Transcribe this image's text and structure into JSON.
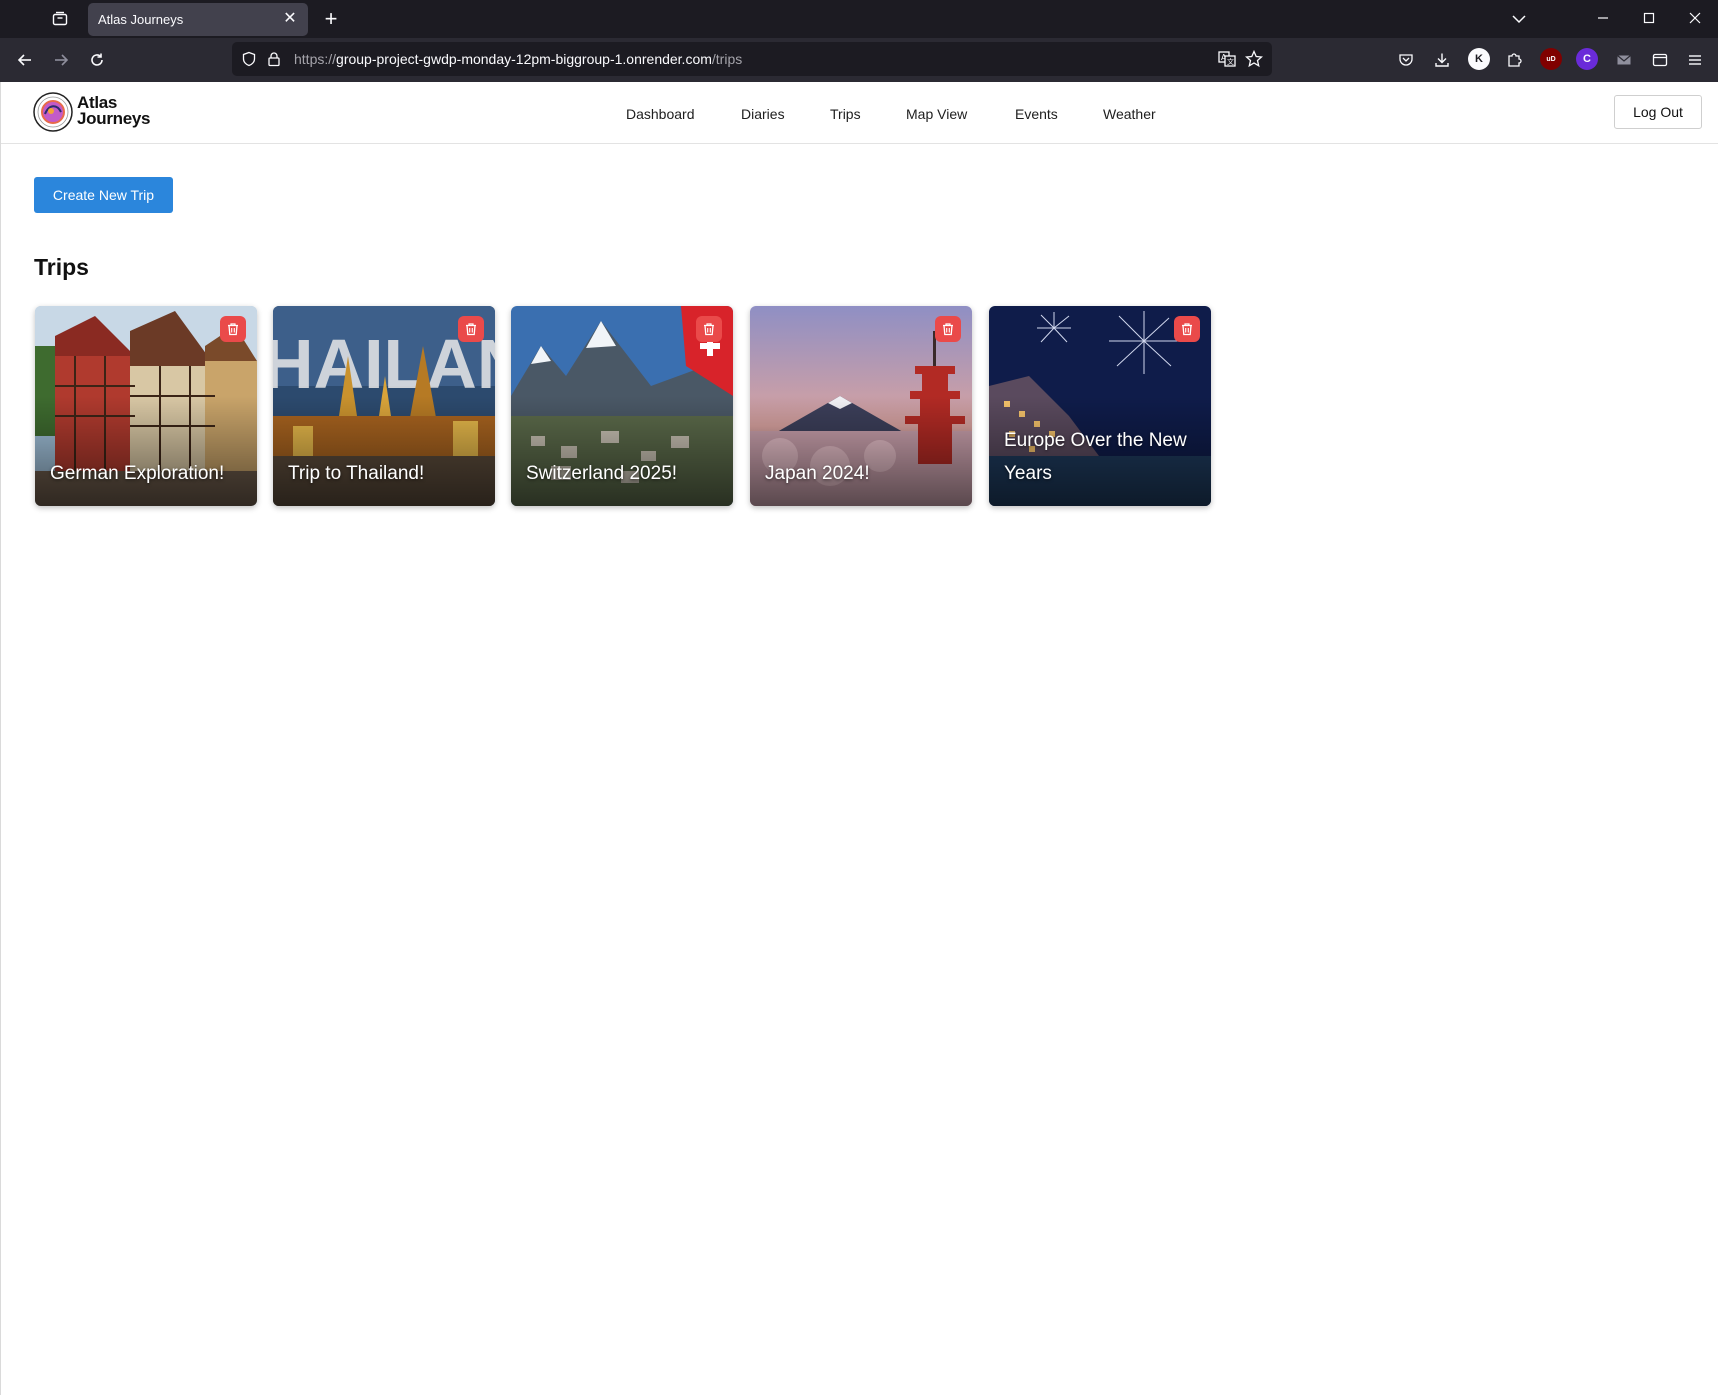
{
  "browser": {
    "tab_title": "Atlas Journeys",
    "tab_close": "✕",
    "new_tab": "+",
    "url_prefix": "https://",
    "url_host": "group-project-gwdp-monday-12pm-biggroup-1.onrender.com",
    "url_path": "/trips",
    "extensions": [
      {
        "name": "k-extension",
        "label": "K",
        "color": "#ffffff"
      },
      {
        "name": "ublock-extension",
        "label": "uD",
        "color": "#800000"
      },
      {
        "name": "c-extension",
        "label": "C",
        "color": "#6a2bd9"
      }
    ]
  },
  "header": {
    "brand_line1": "Atlas",
    "brand_line2": "Journeys",
    "nav": [
      "Dashboard",
      "Diaries",
      "Trips",
      "Map View",
      "Events",
      "Weather"
    ],
    "logout_label": "Log Out"
  },
  "main": {
    "create_label": "Create New Trip",
    "section_title": "Trips",
    "trips": [
      {
        "title": "German Exploration!"
      },
      {
        "title": "Trip to Thailand!"
      },
      {
        "title": "Switzerland 2025!"
      },
      {
        "title": "Japan 2024!"
      },
      {
        "title": "Europe Over the New Years"
      }
    ]
  },
  "colors": {
    "primary_button": "#2b86dc",
    "delete_button": "#ea4a4a",
    "browser_dark": "#1c1b22"
  }
}
